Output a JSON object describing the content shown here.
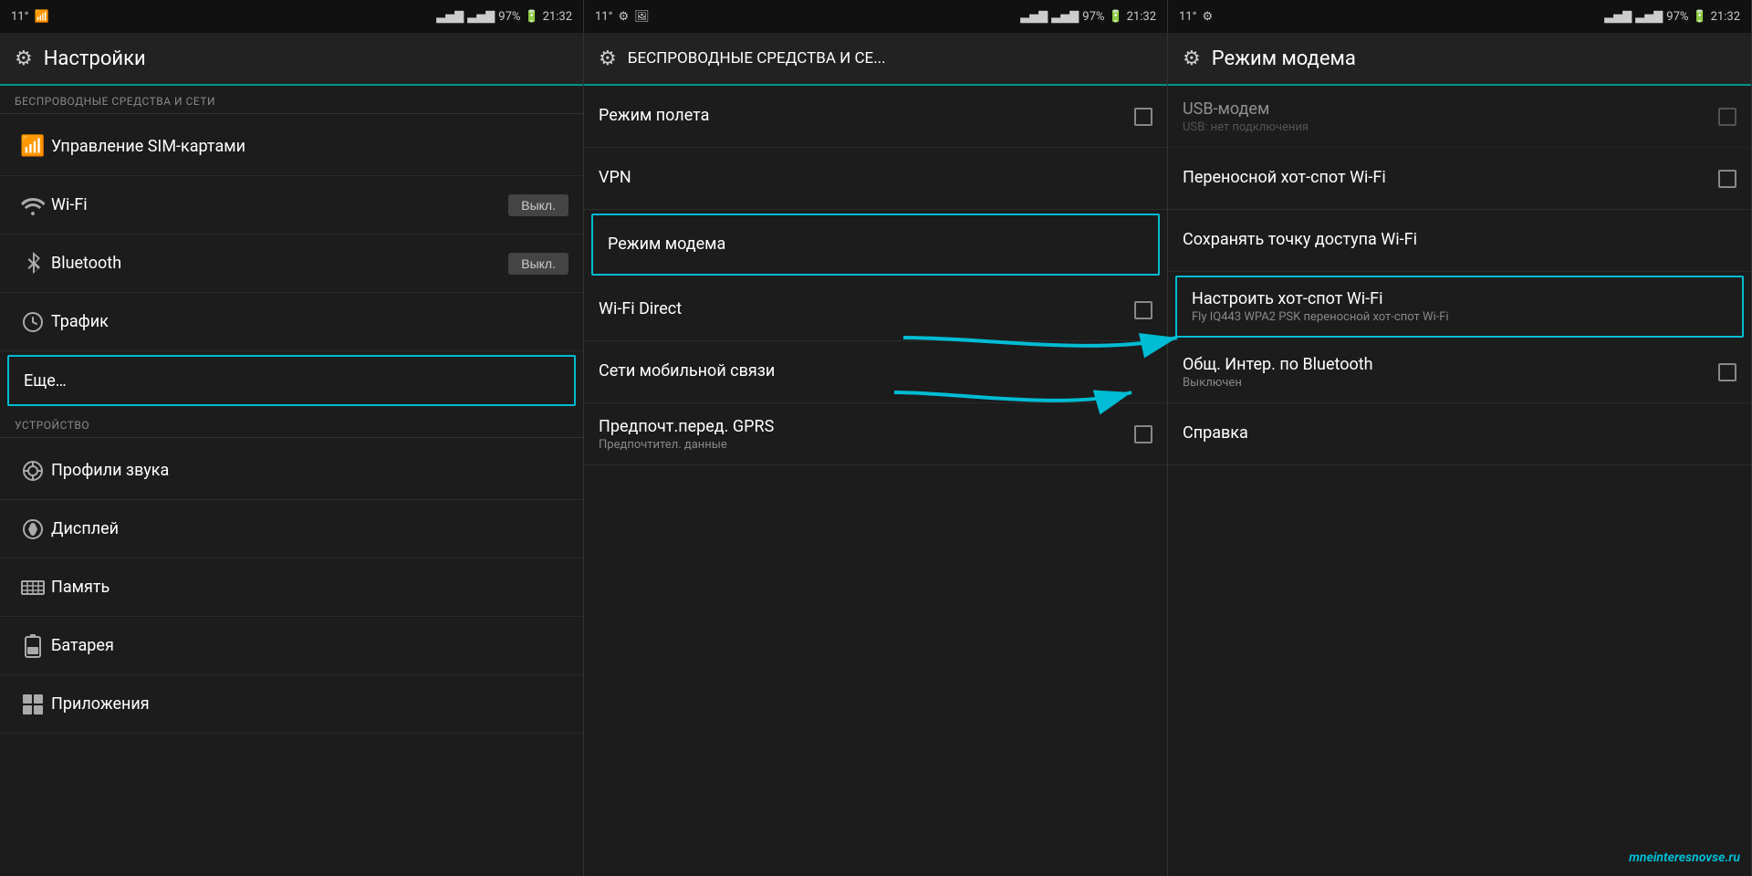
{
  "panels": [
    {
      "id": "panel1",
      "statusBar": {
        "left": "11°",
        "signal1": true,
        "signal2": true,
        "battery": "97%",
        "time": "21:32"
      },
      "header": {
        "icon": "⚙",
        "title": "Настройки"
      },
      "sections": [
        {
          "label": "БЕСПРОВОДНЫЕ СРЕДСТВА И СЕТИ",
          "items": [
            {
              "icon": "📶",
              "text": "Управление SIM-картами",
              "toggle": null,
              "highlighted": false
            },
            {
              "icon": "📡",
              "text": "Wi-Fi",
              "toggle": "Выкл.",
              "highlighted": false
            },
            {
              "icon": "🔵",
              "text": "Bluetooth",
              "toggle": "Выкл.",
              "highlighted": false
            },
            {
              "icon": "🕐",
              "text": "Трафик",
              "toggle": null,
              "highlighted": false
            },
            {
              "icon": null,
              "text": "Еще…",
              "toggle": null,
              "highlighted": true
            }
          ]
        },
        {
          "label": "УСТРОЙСТВО",
          "items": [
            {
              "icon": "🎵",
              "text": "Профили звука",
              "toggle": null,
              "highlighted": false
            },
            {
              "icon": "💡",
              "text": "Дисплей",
              "toggle": null,
              "highlighted": false
            },
            {
              "icon": "💾",
              "text": "Память",
              "toggle": null,
              "highlighted": false
            },
            {
              "icon": "🔋",
              "text": "Батарея",
              "toggle": null,
              "highlighted": false
            },
            {
              "icon": "📱",
              "text": "Приложения",
              "toggle": null,
              "highlighted": false
            }
          ]
        }
      ]
    },
    {
      "id": "panel2",
      "statusBar": {
        "left": "11°",
        "battery": "97%",
        "time": "21:32"
      },
      "header": {
        "icon": "⚙",
        "title": "БЕСПРОВОДНЫЕ СРЕДСТВА И СЕ..."
      },
      "items": [
        {
          "title": "Режим полета",
          "desc": null,
          "checkbox": true,
          "highlighted": false
        },
        {
          "title": "VPN",
          "desc": null,
          "checkbox": false,
          "highlighted": false
        },
        {
          "title": "Режим модема",
          "desc": null,
          "checkbox": false,
          "highlighted": true
        },
        {
          "title": "Wi-Fi Direct",
          "desc": null,
          "checkbox": true,
          "highlighted": false
        },
        {
          "title": "Сети мобильной связи",
          "desc": null,
          "checkbox": false,
          "highlighted": false
        },
        {
          "title": "Предпочт.перед. GPRS",
          "desc": "Предпочтител. данные",
          "checkbox": true,
          "highlighted": false
        }
      ]
    },
    {
      "id": "panel3",
      "statusBar": {
        "left": "11°",
        "battery": "97%",
        "time": "21:32"
      },
      "header": {
        "icon": "⚙",
        "title": "Режим модема"
      },
      "items": [
        {
          "title": "USB-модем",
          "desc": "USB: нет подключения",
          "checkbox": true,
          "highlighted": false,
          "disabled": true
        },
        {
          "title": "Переносной хот-спот Wi-Fi",
          "desc": null,
          "checkbox": true,
          "highlighted": false
        },
        {
          "title": "Сохранять точку доступа Wi-Fi",
          "desc": null,
          "checkbox": false,
          "highlighted": false
        },
        {
          "title": "Настроить хот-спот Wi-Fi",
          "desc": "Fly IQ443 WPA2 PSK переносной хот-спот Wi-Fi",
          "checkbox": false,
          "highlighted": true
        },
        {
          "title": "Общ. Интер. по Bluetooth",
          "desc": "Выключен",
          "checkbox": true,
          "highlighted": false
        },
        {
          "title": "Справка",
          "desc": null,
          "checkbox": false,
          "highlighted": false
        }
      ],
      "watermark": "mneinteresnovse.ru"
    }
  ]
}
